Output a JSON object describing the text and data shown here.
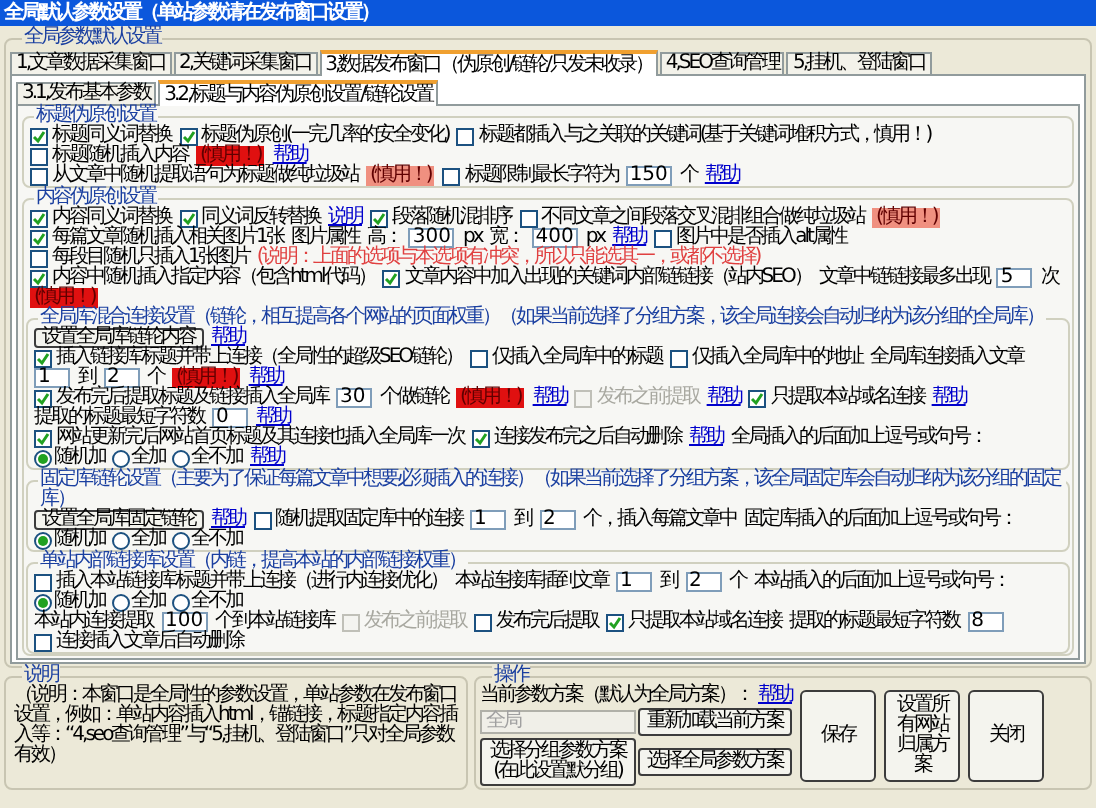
{
  "window": {
    "title": "全局默认参数设置（单站参数请在发布窗口设置）"
  },
  "group_title": "全局参数默认设置",
  "tabs": [
    {
      "label": "1,文章数据采集窗口",
      "selected": false
    },
    {
      "label": "2,关键词采集窗口",
      "selected": false
    },
    {
      "label": "3,数据发布窗口（伪原创/链轮/只发未收录）",
      "selected": true
    },
    {
      "label": "4,SEO查询管理",
      "selected": false
    },
    {
      "label": "5,挂机、登陆窗口",
      "selected": false
    }
  ],
  "subtabs": [
    {
      "label": "3.1,发布基本参数",
      "selected": false
    },
    {
      "label": "3.2,标题与内容伪原创设置/链轮设置",
      "selected": true
    }
  ],
  "sections": [
    {
      "title": "标题伪原创设置",
      "lines": [
        {
          "items": [
            {
              "kind": "check",
              "label": "标题同义词替换",
              "checked": true,
              "disabled": false
            },
            {
              "kind": "check",
              "label": "标题伪原创(一完几率的安全变化)",
              "checked": true,
              "disabled": false
            },
            {
              "kind": "check",
              "label": "标题都插入与之关联的关键词(基于关键词堆积方式，慎用！)",
              "checked": false,
              "disabled": false
            },
            {
              "kind": "check",
              "label": "标题随机插入内容",
              "checked": false,
              "disabled": false
            },
            {
              "kind": "warn",
              "label": "(慎用！)",
              "color": "#e01010"
            },
            {
              "kind": "link",
              "label": "帮助"
            }
          ]
        },
        {
          "items": [
            {
              "kind": "check",
              "label": "从文章中随机提取语句为标题做纯垃圾站",
              "checked": false,
              "disabled": false
            },
            {
              "kind": "warn",
              "label": "(慎用！)",
              "color": "#f09080"
            },
            {
              "kind": "check",
              "label": "标题限制最长字符为",
              "checked": false,
              "disabled": false
            },
            {
              "kind": "input",
              "value": "150"
            },
            {
              "kind": "text",
              "label": "个"
            },
            {
              "kind": "link",
              "label": "帮助"
            }
          ]
        }
      ]
    },
    {
      "title": "内容伪原创设置",
      "lines": [
        {
          "items": [
            {
              "kind": "check",
              "label": "内容同义词替换",
              "checked": true,
              "disabled": false
            },
            {
              "kind": "check",
              "label": "同义词反转替换",
              "checked": true,
              "disabled": false
            },
            {
              "kind": "link",
              "label": "说明"
            },
            {
              "kind": "check",
              "label": "段落随机混排序",
              "checked": true,
              "disabled": false
            },
            {
              "kind": "check",
              "label": "不同文章之间段落交叉混排组合做纯垃圾站",
              "checked": false,
              "disabled": false
            },
            {
              "kind": "warn",
              "label": "(慎用！)",
              "color": "#f09080"
            }
          ]
        },
        {
          "items": [
            {
              "kind": "check",
              "label": "每篇文章随机插入相关图片1张",
              "checked": true,
              "disabled": false
            },
            {
              "kind": "text",
              "label": "图片属性"
            },
            {
              "kind": "text",
              "label": "高："
            },
            {
              "kind": "input",
              "value": "300"
            },
            {
              "kind": "text",
              "label": "px"
            },
            {
              "kind": "text",
              "label": "宽："
            },
            {
              "kind": "input",
              "value": "400"
            },
            {
              "kind": "text",
              "label": "px"
            },
            {
              "kind": "link",
              "label": "帮助"
            },
            {
              "kind": "check",
              "label": "图片中是否插入alt属性",
              "checked": false,
              "disabled": false
            }
          ]
        },
        {
          "items": [
            {
              "kind": "check",
              "label": "每段目随机只插入1张图片",
              "checked": false,
              "disabled": false
            },
            {
              "kind": "note",
              "label": "(说明：上面的选项与本选项有冲突，所以只能选其一，或都不选择)"
            }
          ]
        },
        {
          "items": [
            {
              "kind": "check",
              "label": "内容中随机插入指定内容（包含html代码）",
              "checked": true,
              "disabled": false
            },
            {
              "kind": "check",
              "label": "文章内容中加入出现的关键词内部链链接（站内SEO）",
              "checked": true,
              "disabled": false
            },
            {
              "kind": "text",
              "label": "文章中链链接最多出现"
            },
            {
              "kind": "input",
              "value": "5"
            },
            {
              "kind": "text",
              "label": "次"
            },
            {
              "kind": "warn",
              "label": "(慎用！)",
              "color": "#e01010"
            }
          ]
        }
      ],
      "subsections": [
        {
          "title": "全局库混合连接设置（链轮，相互提高各个网站的页面权重）（如果当前选择了分组方案，该全局连接会自动归纳为该分组的全局库）",
          "lines": [
            {
              "items": [
                {
                  "kind": "button",
                  "label": "设置全局库链轮内容"
                },
                {
                  "kind": "link",
                  "label": "帮助"
                }
              ]
            },
            {
              "items": [
                {
                  "kind": "check",
                  "label": "插入链接库标题并带上连接（全局性的超级SEO链轮）",
                  "checked": true,
                  "disabled": false
                },
                {
                  "kind": "check",
                  "label": "仅插入全局库中的标题",
                  "checked": false,
                  "disabled": false
                },
                {
                  "kind": "check",
                  "label": "仅插入全局库中的地址",
                  "checked": false,
                  "disabled": false
                },
                {
                  "kind": "text",
                  "label": "全局库连接插入文章"
                },
                {
                  "kind": "input",
                  "value": "1"
                },
                {
                  "kind": "text",
                  "label": "到"
                },
                {
                  "kind": "input",
                  "value": "2"
                },
                {
                  "kind": "text",
                  "label": "个"
                },
                {
                  "kind": "warn",
                  "label": "(慎用！)",
                  "color": "#e01010"
                },
                {
                  "kind": "link",
                  "label": "帮助"
                }
              ]
            },
            {
              "items": [
                {
                  "kind": "check",
                  "label": "发布完后提取标题及链接插入全局库",
                  "checked": true,
                  "disabled": false
                },
                {
                  "kind": "input",
                  "value": "30"
                },
                {
                  "kind": "text",
                  "label": "个做链轮"
                },
                {
                  "kind": "warn",
                  "label": "(慎用！)",
                  "color": "#e01010"
                },
                {
                  "kind": "link",
                  "label": "帮助"
                },
                {
                  "kind": "check",
                  "label": "发布之前提取",
                  "checked": false,
                  "disabled": true
                },
                {
                  "kind": "link",
                  "label": "帮助"
                },
                {
                  "kind": "check",
                  "label": "只提取本站域名连接",
                  "checked": true,
                  "disabled": false
                },
                {
                  "kind": "link",
                  "label": "帮助"
                },
                {
                  "kind": "text",
                  "label": "提取的标题最短字符数"
                },
                {
                  "kind": "input",
                  "value": "0"
                },
                {
                  "kind": "link",
                  "label": "帮助"
                }
              ]
            },
            {
              "items": [
                {
                  "kind": "check",
                  "label": "网站更新完后网站首页标题及其连接也插入全局库一次",
                  "checked": true,
                  "disabled": false
                },
                {
                  "kind": "check",
                  "label": "连接发布完之后自动删除",
                  "checked": true,
                  "disabled": false
                },
                {
                  "kind": "link",
                  "label": "帮助"
                },
                {
                  "kind": "text",
                  "label": "全局插入的后面加上逗号或句号："
                },
                {
                  "kind": "radios",
                  "options": [
                    {
                      "label": "随机加",
                      "selected": true
                    },
                    {
                      "label": "全加",
                      "selected": false
                    },
                    {
                      "label": "全不加",
                      "selected": false
                    }
                  ]
                },
                {
                  "kind": "link",
                  "label": "帮助"
                }
              ]
            }
          ]
        },
        {
          "title": "固定库链轮设置（主要为了保证每篇文章中想要必须插入的连接）（如果当前选择了分组方案，该全局固定库会自动归纳为该分组的固定库）",
          "lines": [
            {
              "items": [
                {
                  "kind": "button",
                  "label": "设置全局库固定链轮"
                },
                {
                  "kind": "link",
                  "label": "帮助"
                },
                {
                  "kind": "check",
                  "label": "随机提取固定库中的连接",
                  "checked": false,
                  "disabled": false
                },
                {
                  "kind": "input",
                  "value": "1"
                },
                {
                  "kind": "text",
                  "label": "到"
                },
                {
                  "kind": "input",
                  "value": "2"
                },
                {
                  "kind": "text",
                  "label": "个，插入每篇文章中"
                },
                {
                  "kind": "text",
                  "label": "固定库插入的后面加上逗号或句号："
                },
                {
                  "kind": "radios",
                  "options": [
                    {
                      "label": "随机加",
                      "selected": true
                    },
                    {
                      "label": "全加",
                      "selected": false
                    },
                    {
                      "label": "全不加",
                      "selected": false
                    }
                  ]
                }
              ]
            }
          ]
        },
        {
          "title": "单站内部链接库设置（内链，提高本站的内部链接权重）",
          "lines": [
            {
              "items": [
                {
                  "kind": "check",
                  "label": "插入本站链接库标题并带上连接（进行内连接优化）",
                  "checked": false,
                  "disabled": false
                },
                {
                  "kind": "text",
                  "label": "本站连接库插到文章"
                },
                {
                  "kind": "input",
                  "value": "1"
                },
                {
                  "kind": "text",
                  "label": "到"
                },
                {
                  "kind": "input",
                  "value": "2"
                },
                {
                  "kind": "text",
                  "label": "个"
                },
                {
                  "kind": "text",
                  "label": "本站插入的后面加上逗号或句号："
                },
                {
                  "kind": "radios",
                  "options": [
                    {
                      "label": "随机加",
                      "selected": true
                    },
                    {
                      "label": "全加",
                      "selected": false
                    },
                    {
                      "label": "全不加",
                      "selected": false
                    }
                  ]
                }
              ]
            },
            {
              "items": [
                {
                  "kind": "text",
                  "label": "本站内连接提取"
                },
                {
                  "kind": "input",
                  "value": "100"
                },
                {
                  "kind": "text",
                  "label": "个到本站链接库"
                },
                {
                  "kind": "check",
                  "label": "发布之前提取",
                  "checked": false,
                  "disabled": true
                },
                {
                  "kind": "check",
                  "label": "发布完后提取",
                  "checked": false,
                  "disabled": false
                },
                {
                  "kind": "check",
                  "label": "只提取本站域名连接",
                  "checked": true,
                  "disabled": false
                },
                {
                  "kind": "text",
                  "label": "提取的标题最短字符数"
                },
                {
                  "kind": "input",
                  "value": "8"
                },
                {
                  "kind": "check",
                  "label": "连接插入文章后自动删除",
                  "checked": false,
                  "disabled": false
                }
              ]
            }
          ]
        }
      ]
    }
  ],
  "notes": {
    "title": "说明",
    "text": "（说明：本窗口是全局性的参数设置，单站参数在发布窗口设置，例如：单站内容插入html，锚链接，标题指定内容插入等：“4,seo查询管理”与“5,挂机、登陆窗口”只对全局参数有效）"
  },
  "operations": {
    "title": "操作",
    "scheme_label": "当前参数方案（默认为全局方案）：",
    "help": "帮助",
    "scheme_value": "全局",
    "buttons": [
      {
        "label": "重新加载当前方案"
      },
      {
        "label": "选择分组参数方案\n(在此设置默分组)"
      },
      {
        "label": "选择全局参数方案"
      }
    ],
    "big_buttons": [
      {
        "label": "保存"
      },
      {
        "label": "设置所有网站归属方案"
      },
      {
        "label": "关闭"
      }
    ]
  }
}
